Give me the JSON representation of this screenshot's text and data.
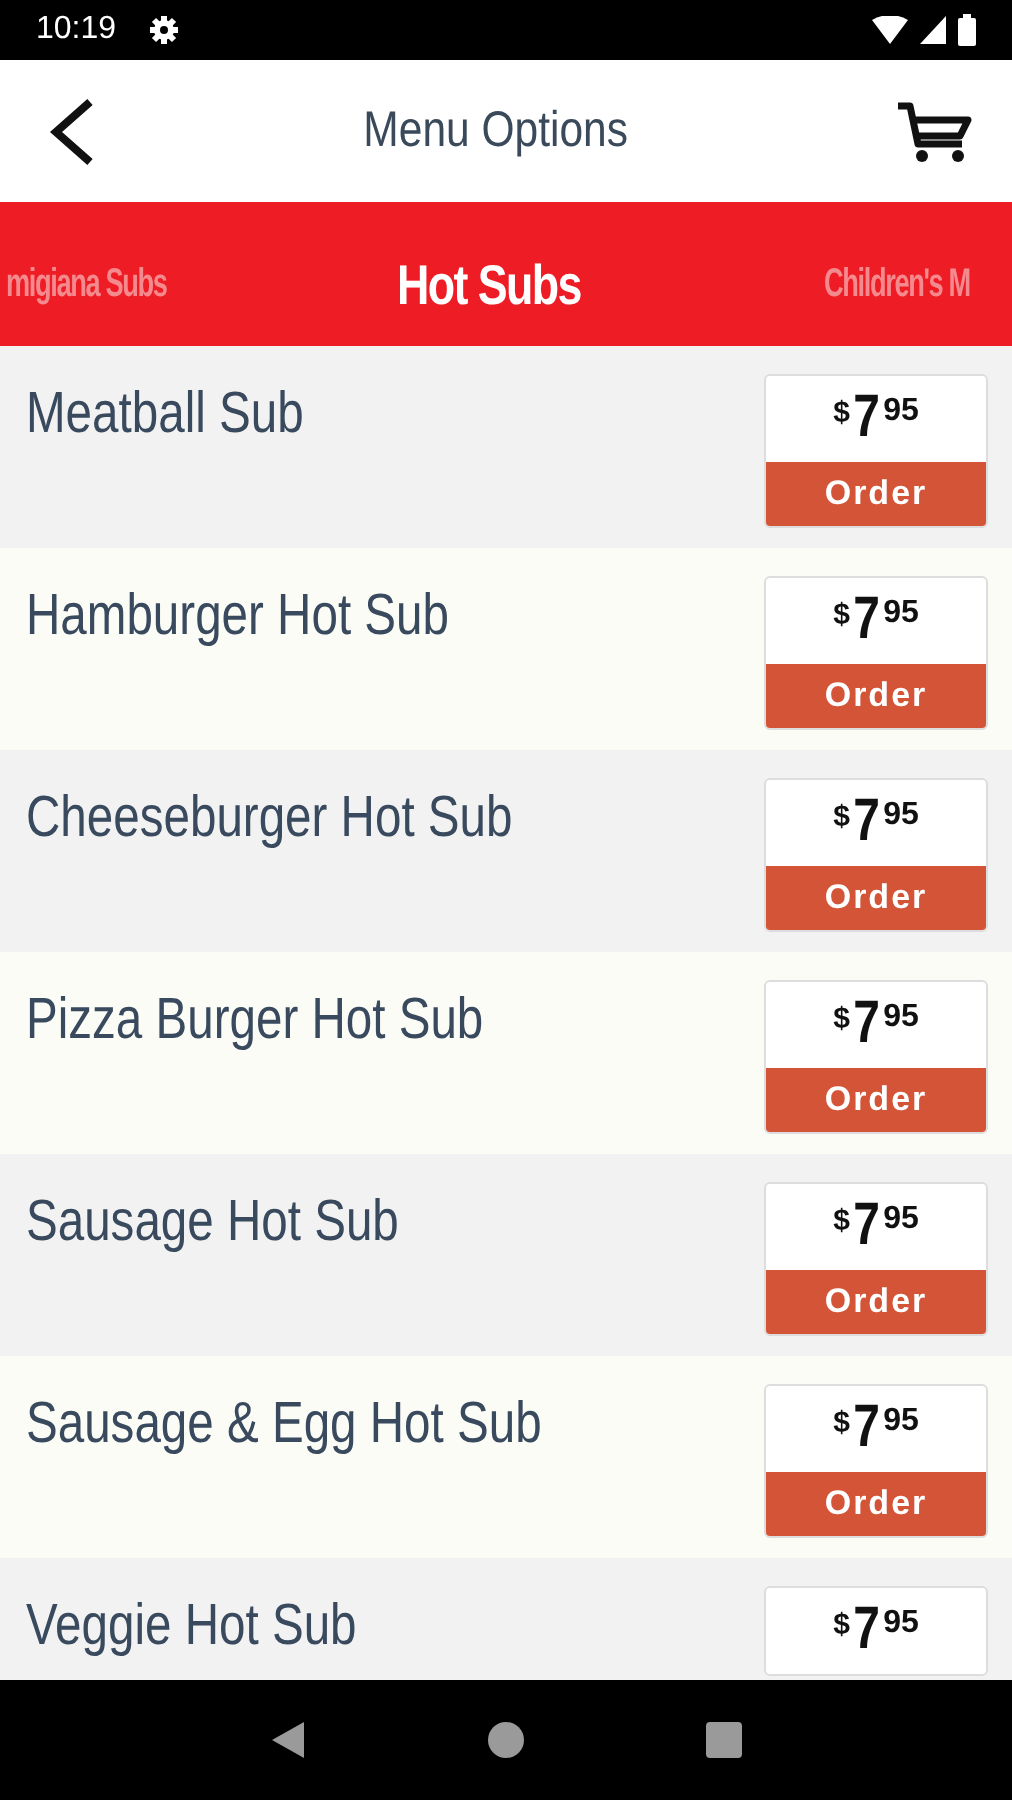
{
  "status_bar": {
    "time": "10:19"
  },
  "header": {
    "title": "Menu Options"
  },
  "tabs": [
    {
      "label": "migiana Subs",
      "selected": false
    },
    {
      "label": "Hot Subs",
      "selected": true
    },
    {
      "label": "Children's M",
      "selected": false
    }
  ],
  "items": [
    {
      "name": "Meatball Sub",
      "price": {
        "currency": "$",
        "dollars": "7",
        "cents": "95"
      },
      "button": "Order"
    },
    {
      "name": "Hamburger Hot Sub",
      "price": {
        "currency": "$",
        "dollars": "7",
        "cents": "95"
      },
      "button": "Order"
    },
    {
      "name": "Cheeseburger Hot Sub",
      "price": {
        "currency": "$",
        "dollars": "7",
        "cents": "95"
      },
      "button": "Order"
    },
    {
      "name": "Pizza Burger Hot Sub",
      "price": {
        "currency": "$",
        "dollars": "7",
        "cents": "95"
      },
      "button": "Order"
    },
    {
      "name": "Sausage Hot Sub",
      "price": {
        "currency": "$",
        "dollars": "7",
        "cents": "95"
      },
      "button": "Order"
    },
    {
      "name": "Sausage & Egg Hot Sub",
      "price": {
        "currency": "$",
        "dollars": "7",
        "cents": "95"
      },
      "button": "Order"
    },
    {
      "name": "Veggie Hot Sub",
      "price": {
        "currency": "$",
        "dollars": "7",
        "cents": "95"
      }
    }
  ]
}
